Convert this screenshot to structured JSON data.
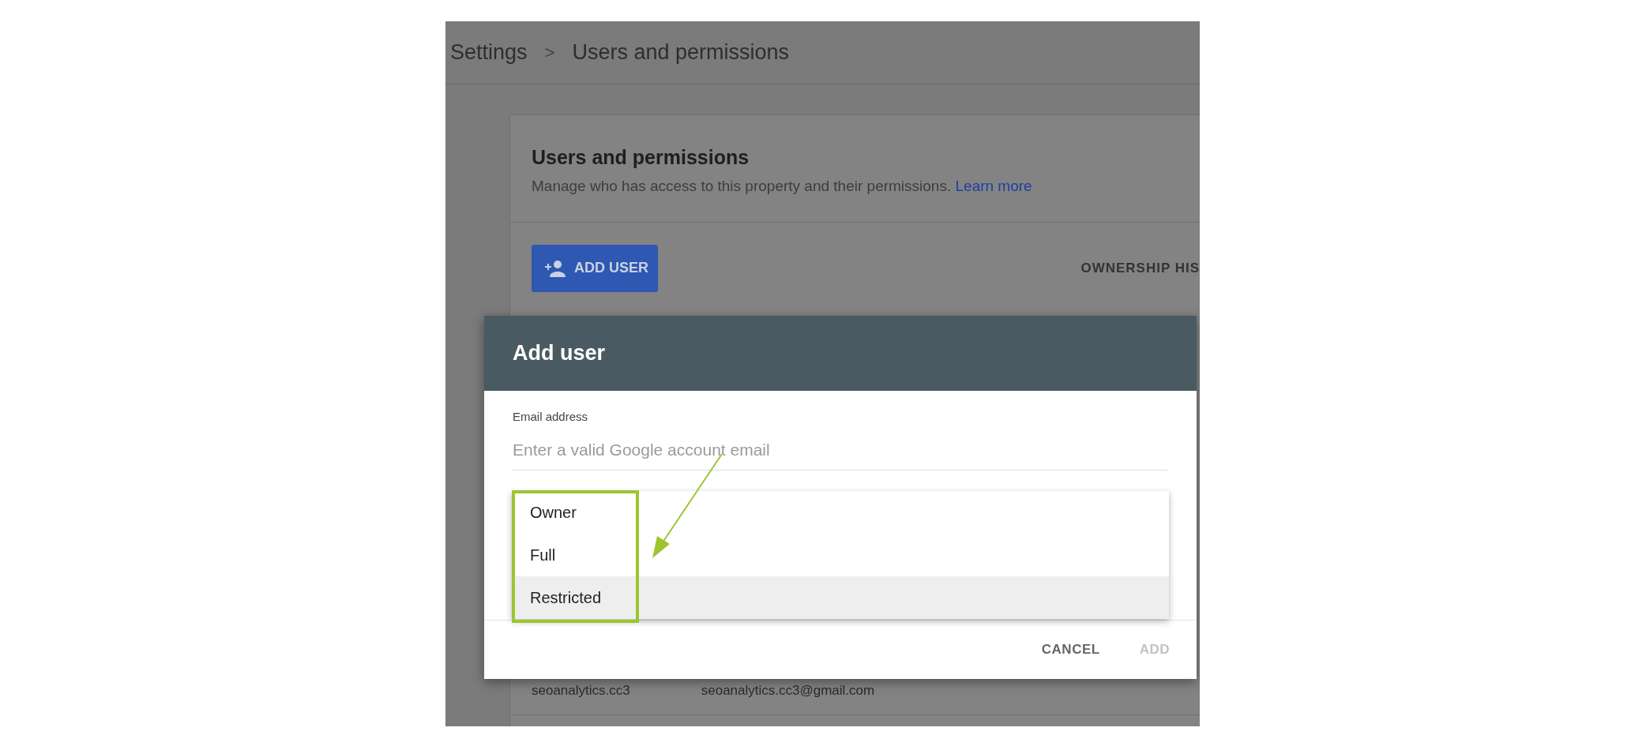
{
  "breadcrumb": {
    "items": [
      {
        "label": "Settings"
      },
      {
        "label": "Users and permissions"
      }
    ],
    "separator": ">"
  },
  "card": {
    "title": "Users and permissions",
    "description": "Manage who has access to this property and their permissions.",
    "link": "Learn more",
    "add_button": "ADD USER",
    "ownership_button": "OWNERSHIP HIS"
  },
  "users": [
    {
      "name": "seoanalytics.cc3",
      "email": "seoanalytics.cc3@gmail.com"
    }
  ],
  "dialog": {
    "title": "Add user",
    "field": {
      "label": "Email address",
      "placeholder": "Enter a valid Google account email"
    },
    "menu": [
      {
        "label": "Owner",
        "selected": false
      },
      {
        "label": "Full",
        "selected": false
      },
      {
        "label": "Restricted",
        "selected": true
      }
    ],
    "buttons": [
      {
        "label": "CANCEL",
        "disabled": false
      },
      {
        "label": "ADD",
        "disabled": true
      }
    ]
  }
}
